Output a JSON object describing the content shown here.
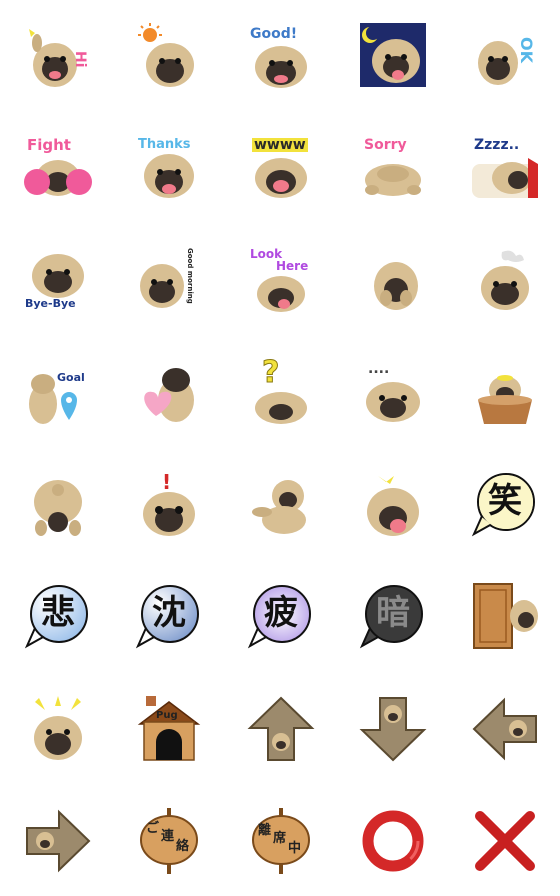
{
  "colors": {
    "pug_fawn": "#d8bf93",
    "pug_mask": "#3a302a",
    "pink": "#f05a9a",
    "blue": "#3e7ac8",
    "sky": "#57b7e8",
    "purple": "#b04ae0",
    "yellow": "#f2e23c",
    "red": "#d42828",
    "wood": "#c98a4a",
    "stone": "#9c8a6c"
  },
  "stickers": {
    "hi": {
      "text": "Hi"
    },
    "good": {
      "text": "Good!"
    },
    "ok": {
      "text": "OK"
    },
    "fight": {
      "text": "Fight"
    },
    "thanks": {
      "text": "Thanks"
    },
    "wwww": {
      "text": "wwww"
    },
    "sorry": {
      "text": "Sorry"
    },
    "zzz": {
      "text": "Zzzz.."
    },
    "byebye": {
      "text": "Bye-Bye"
    },
    "ohayo": {
      "text": "Good morning"
    },
    "lookhere": {
      "line1": "Look",
      "line2": "Here"
    },
    "goal": {
      "text": "Goal"
    },
    "question": {
      "text": "?"
    },
    "dots": {
      "text": "...."
    },
    "exclaim": {
      "text": "!"
    },
    "warai": {
      "text": "笑"
    },
    "kanashii": {
      "text": "悲"
    },
    "chin": {
      "text": "沈"
    },
    "tsukare": {
      "text": "疲"
    },
    "kurai": {
      "text": "暗"
    },
    "pughouse": {
      "text": "Pug"
    },
    "gorenraku": {
      "line1": "ご",
      "line2": "連",
      "line3": "絡"
    },
    "riseki": {
      "line1": "離",
      "line2": "席",
      "line3": "中"
    }
  }
}
